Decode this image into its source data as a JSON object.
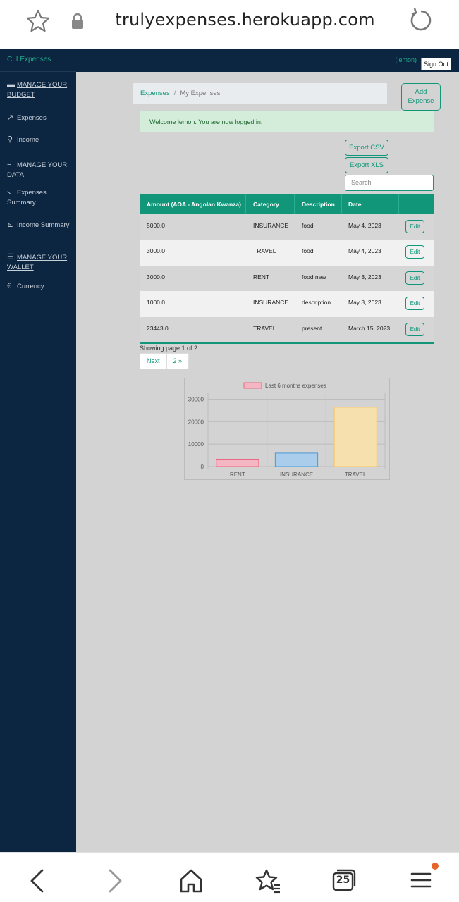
{
  "browser": {
    "url": "trulyexpenses.herokuapp.com",
    "tab_count": "25"
  },
  "sidebar": {
    "brand": "CLI Expenses",
    "items": [
      {
        "label": "MANAGE YOUR BUDGET",
        "icon": "wallet-icon"
      },
      {
        "label": "Expenses",
        "icon": "share-icon"
      },
      {
        "label": "Income",
        "icon": "walking-icon"
      },
      {
        "label": "MANAGE YOUR DATA",
        "icon": "database-icon"
      },
      {
        "label": "Expenses Summary",
        "icon": "line-chart-icon"
      },
      {
        "label": "Income Summary",
        "icon": "area-chart-icon"
      },
      {
        "label": "MANAGE YOUR WALLET",
        "icon": "coins-icon"
      },
      {
        "label": "Currency",
        "icon": "euro-icon"
      }
    ]
  },
  "navbar": {
    "user": "(lemon)",
    "signout": "Sign Out"
  },
  "breadcrumb": {
    "root": "Expenses",
    "separator": "/",
    "current": "My Expenses"
  },
  "add_button": "Add Expense",
  "alert": "Welcome lemon. You are now logged in.",
  "export": {
    "csv": "Export CSV",
    "xls": "Export XLS"
  },
  "search": {
    "placeholder": "Search"
  },
  "table": {
    "headers": [
      "Amount (AOA - Angolan Kwanza)",
      "Category",
      "Description",
      "Date",
      ""
    ],
    "rows": [
      {
        "amount": "5000.0",
        "category": "INSURANCE",
        "description": "food",
        "date": "May 4, 2023",
        "action": "Edit"
      },
      {
        "amount": "3000.0",
        "category": "TRAVEL",
        "description": "food",
        "date": "May 4, 2023",
        "action": "Edit"
      },
      {
        "amount": "3000.0",
        "category": "RENT",
        "description": "food new",
        "date": "May 3, 2023",
        "action": "Edit"
      },
      {
        "amount": "1000.0",
        "category": "INSURANCE",
        "description": "description",
        "date": "May 3, 2023",
        "action": "Edit"
      },
      {
        "amount": "23443.0",
        "category": "TRAVEL",
        "description": "present",
        "date": "March 15, 2023",
        "action": "Edit"
      }
    ]
  },
  "pagination": {
    "info": "Showing page 1 of 2",
    "next": "Next",
    "page2": "2 »"
  },
  "chart_data": {
    "type": "bar",
    "categories": [
      "RENT",
      "INSURANCE",
      "TRAVEL"
    ],
    "series": [
      {
        "name": "Last 6 months expenses",
        "values": [
          3000,
          6000,
          26443
        ]
      }
    ],
    "bar_colors": [
      "#f4b6c2",
      "#a9cdea",
      "#f6e0ad"
    ],
    "bar_border_colors": [
      "#e8677f",
      "#4a9ad6",
      "#f3c468"
    ],
    "y_ticks": [
      "0",
      "10000",
      "20000",
      "30000"
    ],
    "ylim": [
      0,
      33000
    ],
    "grid": true,
    "legend": "top"
  },
  "colors": {
    "accent": "#11967a",
    "sidebar": "#0c2540",
    "page_bg": "#d3d3d3"
  }
}
